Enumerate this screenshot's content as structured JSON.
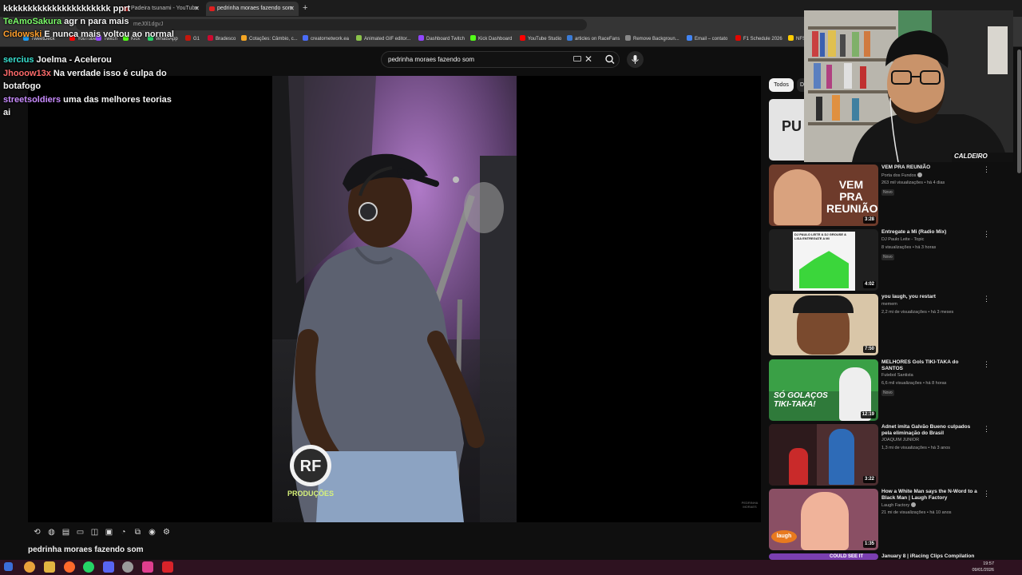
{
  "browser": {
    "tabs": [
      {
        "label": "Padeira tsunami - YouTube",
        "active": false
      },
      {
        "label": "pedrinha moraes fazendo som",
        "active": true
      }
    ],
    "new_tab_label": "+",
    "url": "meJ0l1dgvJ",
    "bookmarks": [
      {
        "label": "TweetDeck",
        "color": "#1d9bf0"
      },
      {
        "label": "YouTube",
        "color": "#ff0000"
      },
      {
        "label": "Twitch",
        "color": "#9146ff"
      },
      {
        "label": "Kick",
        "color": "#53fc18"
      },
      {
        "label": "WhatsApp",
        "color": "#25d366"
      },
      {
        "label": "G1",
        "color": "#c4170c"
      },
      {
        "label": "Bradesco",
        "color": "#cc092f"
      },
      {
        "label": "Cotações: Câmbio, c...",
        "color": "#f5a623"
      },
      {
        "label": "creatornetwork.ea",
        "color": "#4a6cf7"
      },
      {
        "label": "Animated GIF editor...",
        "color": "#8bc34a"
      },
      {
        "label": "Dashboard Twitch",
        "color": "#9146ff"
      },
      {
        "label": "Kick Dashboard",
        "color": "#53fc18"
      },
      {
        "label": "YouTube Studio",
        "color": "#ff0000"
      },
      {
        "label": "articles on RaceFans",
        "color": "#3a7bd5"
      },
      {
        "label": "Remove Backgroun...",
        "color": "#888888"
      },
      {
        "label": "Email – contato",
        "color": "#4285f4"
      },
      {
        "label": "F1 Schedule 2026",
        "color": "#e10600"
      },
      {
        "label": "NFS",
        "color": "#ffcc00"
      }
    ]
  },
  "youtube": {
    "search_query": "pedrinha moraes fazendo som",
    "video_title": "pedrinha moraes fazendo som",
    "watermark": "PEDRINHA MORAES",
    "logo_text": "PRODUÇÕES",
    "chips": [
      "Todos",
      "D"
    ],
    "first_thumb_text": "PU",
    "recommendations": [
      {
        "title": "VEM PRA REUNIÃO",
        "channel": "Porta dos Fundos",
        "verified": true,
        "meta": "263 mil visualizações • há 4 dias",
        "badge": "Novo",
        "duration": "3:28",
        "thumb_text": "VEM PRA REUNIÃO"
      },
      {
        "title": "Entregate a Mi (Radio Mix)",
        "channel": "DJ Paulo Leite - Topic",
        "verified": false,
        "meta": "8 visualizações • há 3 horas",
        "badge": "Novo",
        "duration": "4:02",
        "thumb_text": "DJ PAULO LEITE & DJ GROUSE & LISA ENTREGATE A MI"
      },
      {
        "title": "you laugh, you restart",
        "channel": "memem",
        "verified": false,
        "meta": "2,2 mi de visualizações • há 3 meses",
        "badge": "",
        "duration": "7:50",
        "thumb_text": ""
      },
      {
        "title": "MELHORES Gols TIKI-TAKA do SANTOS",
        "channel": "Futebol Santista",
        "verified": false,
        "meta": "6,6 mil visualizações • há 8 horas",
        "badge": "Novo",
        "duration": "12:19",
        "thumb_text": "SÓ GOLAÇOS TIKI-TAKA!"
      },
      {
        "title": "Adnet imita Galvão Bueno culpados pela eliminação do Brasil",
        "channel": "JOAQUIM JUNIOR",
        "verified": false,
        "meta": "1,3 mi de visualizações • há 3 anos",
        "badge": "",
        "duration": "3:22",
        "thumb_text": ""
      },
      {
        "title": "How a White Man says the N-Word to a Black Man | Laugh Factory",
        "channel": "Laugh Factory",
        "verified": true,
        "meta": "21 mi de visualizações • há 10 anos",
        "badge": "",
        "duration": "1:35",
        "thumb_text": "laugh"
      },
      {
        "title": "January 8 | iRacing Clips Compilation",
        "channel": "",
        "verified": false,
        "meta": "",
        "badge": "",
        "duration": "",
        "thumb_text": "COULD SEE IT"
      }
    ]
  },
  "webcam": {
    "overlay_label": "CALDEIRO"
  },
  "chat": [
    {
      "user": "",
      "color": "#ffffff",
      "message": "kkkkkkkkkkkkkkkkkkkkkk pprt"
    },
    {
      "user": "TeAmoSakura",
      "color": "#7cfc6a",
      "message": "agr n para mais"
    },
    {
      "user": "Cidowski",
      "color": "#ff9f2d",
      "message": "E nunca mais voltou ao normal"
    },
    {
      "user": "sercius",
      "color": "#38e0d0",
      "message": "Joelma - Acelerou"
    },
    {
      "user": "Jhooow13x",
      "color": "#ff6b6b",
      "message": "Na verdade isso é culpa do botafogo"
    },
    {
      "user": "streetsoldiers",
      "color": "#c98cff",
      "message": "uma das melhores teorias ai"
    }
  ],
  "taskbar": {
    "time": "19:57",
    "date": "09/01/2026"
  }
}
